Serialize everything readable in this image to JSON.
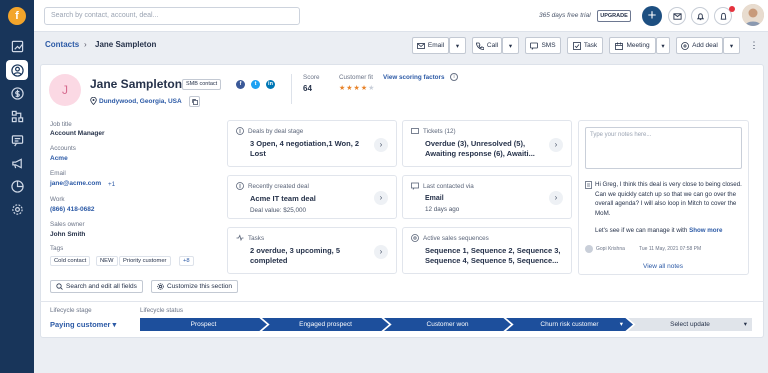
{
  "app": {
    "search_placeholder": "Search by contact, account, deal...",
    "trial": "365 days free trial",
    "upgrade": "UPGRADE"
  },
  "breadcrumb": {
    "parent": "Contacts",
    "current": "Jane Sampleton"
  },
  "actions": {
    "email": "Email",
    "call": "Call",
    "sms": "SMS",
    "task": "Task",
    "meeting": "Meeting",
    "add_deal": "Add deal"
  },
  "contact": {
    "initial": "J",
    "name": "Jane Sampleton",
    "badge": "SMB contact",
    "location": "Dundywood, Georgia, USA",
    "score_label": "Score",
    "score": "64",
    "fit_label": "Customer fit",
    "fit_link": "View scoring factors",
    "fit_stars": "★★★★",
    "fit_empty": "★"
  },
  "fields": {
    "job_title_label": "Job title",
    "job_title": "Account Manager",
    "accounts_label": "Accounts",
    "account": "Acme",
    "email_label": "Email",
    "email": "jane@acme.com",
    "email_more": "+1",
    "work_label": "Work",
    "work": "(866) 418-0682",
    "owner_label": "Sales owner",
    "owner": "John Smith",
    "tags_label": "Tags",
    "tags": [
      "Cold contact",
      "NEW",
      "Priority customer"
    ],
    "tags_more": "+8"
  },
  "tiles": {
    "deals": {
      "label": "Deals by deal stage",
      "value": "3 Open, 4 negotiation,1 Won, 2 Lost"
    },
    "tickets": {
      "label": "Tickets (12)",
      "value": "Overdue (3), Unresolved (5), Awaiting response (6), Awaiti..."
    },
    "recent_deal": {
      "label": "Recently created deal",
      "value": "Acme IT team deal",
      "sub": "Deal value: $25,000"
    },
    "last_contacted": {
      "label": "Last contacted via",
      "value": "Email",
      "sub": "12 days ago"
    },
    "tasks": {
      "label": "Tasks",
      "value": "2 overdue, 3 upcoming, 5 completed"
    },
    "sequences": {
      "label": "Active sales sequences",
      "value": "Sequence 1, Sequence 2, Sequence 3, Sequence 4, Sequence 5, Sequence..."
    }
  },
  "notes": {
    "placeholder": "Type your notes here...",
    "text": "Hi Greg, I think this deal is very close to being closed. Can we quickly catch up so that we can go over the overall agenda? I will also loop in Mitch to cover the MoM.",
    "text2": "Let's see if we can manage it with",
    "show_more": "Show more",
    "author": "Gopi Krishna",
    "date": "Tue 11 May, 2021 07:58 PM",
    "view_all": "View all notes"
  },
  "bottom": {
    "search_edit": "Search and edit all fields",
    "customize": "Customize this section"
  },
  "lifecycle": {
    "stage_label": "Lifecycle stage",
    "stage_value": "Paying customer",
    "status_label": "Lifecycle status",
    "stages": [
      "Prospect",
      "Engaged prospect",
      "Customer won",
      "Churn risk customer",
      "Select update"
    ]
  },
  "colors": {
    "brand": "#18355a",
    "accent": "#1d4f9c",
    "link": "#2c5aa6"
  }
}
